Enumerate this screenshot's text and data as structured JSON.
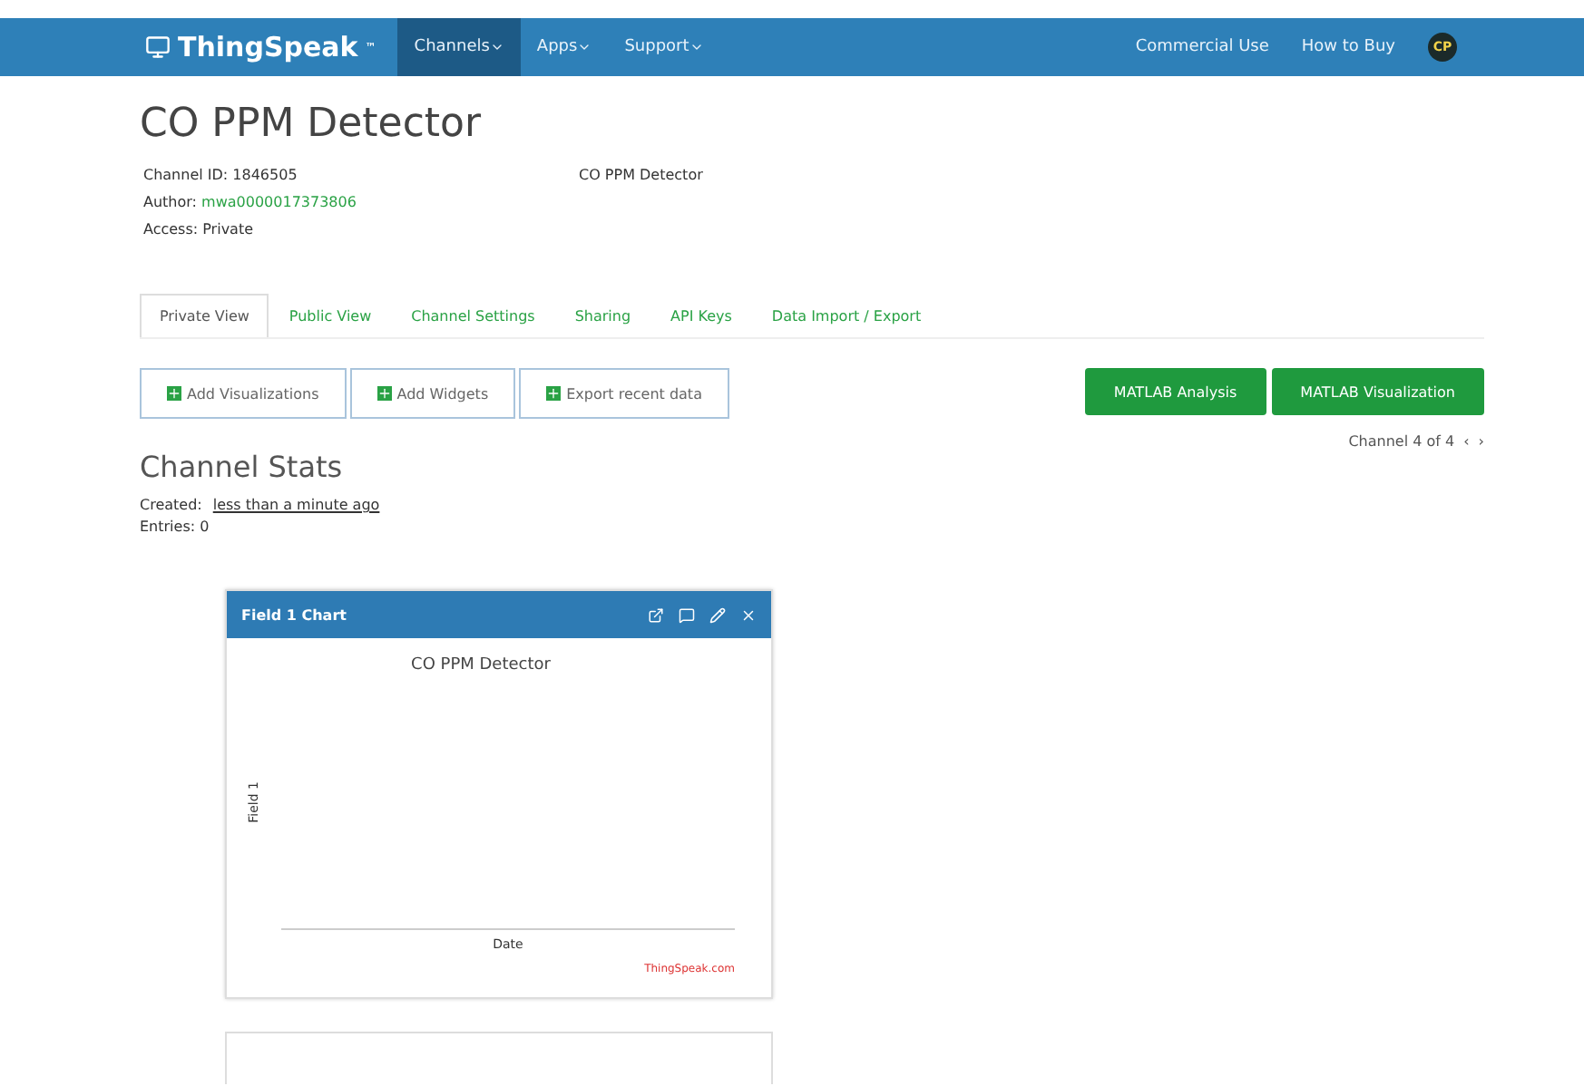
{
  "navbar": {
    "brand": "ThingSpeak",
    "brand_mark": "™",
    "menus": [
      {
        "label": "Channels",
        "selected": true
      },
      {
        "label": "Apps",
        "selected": false
      },
      {
        "label": "Support",
        "selected": false
      }
    ],
    "links": [
      "Commercial Use",
      "How to Buy"
    ],
    "avatar": "CP"
  },
  "channel": {
    "title": "CO PPM Detector",
    "id_label": "Channel ID:",
    "id": "1846505",
    "author_label": "Author:",
    "author": "mwa0000017373806",
    "access": "Access: Private",
    "description": "CO PPM Detector"
  },
  "tabs": [
    {
      "label": "Private View",
      "selected": true
    },
    {
      "label": "Public View",
      "selected": false
    },
    {
      "label": "Channel Settings",
      "selected": false
    },
    {
      "label": "Sharing",
      "selected": false
    },
    {
      "label": "API Keys",
      "selected": false
    },
    {
      "label": "Data Import / Export",
      "selected": false
    }
  ],
  "actions": [
    "Add Visualizations",
    "Add Widgets",
    "Export recent data"
  ],
  "matlab_buttons": [
    "MATLAB Analysis",
    "MATLAB Visualization"
  ],
  "pager": {
    "label": "Channel 4 of 4",
    "prev": "‹",
    "next": "›"
  },
  "stats": {
    "heading": "Channel Stats",
    "created_label": "Created:",
    "created": "less than a minute ago",
    "entries": "Entries: 0"
  },
  "chart_card": {
    "title": "Field 1 Chart",
    "chart_title": "CO PPM Detector",
    "ylabel": "Field 1",
    "xlabel": "Date",
    "credit": "ThingSpeak.com"
  }
}
